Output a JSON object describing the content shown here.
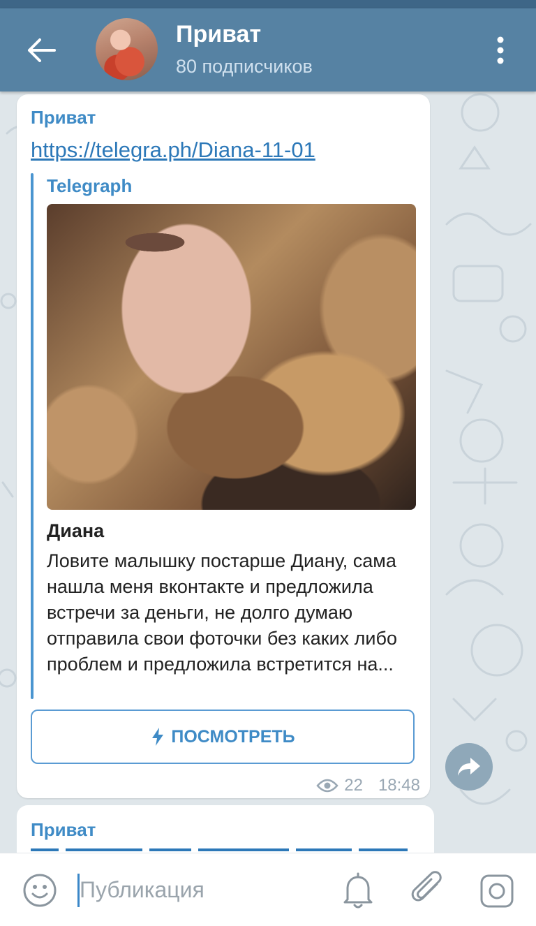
{
  "header": {
    "title": "Приват",
    "subtitle": "80 подписчиков",
    "back_icon": "arrow-left-icon",
    "menu_icon": "more-vertical-icon"
  },
  "messages": [
    {
      "sender": "Приват",
      "link": "https://telegra.ph/Diana-11-01",
      "preview": {
        "site": "Telegraph",
        "title": "Диана",
        "description": "Ловите малышку постарше Диану, сама нашла меня вконтакте и предложила встречи за деньги, не долго думаю отправила свои фоточки без каких либо проблем и предложила встретится на..."
      },
      "button_label": "ПОСМОТРЕТЬ",
      "views": "22",
      "time": "18:48"
    },
    {
      "sender": "Приват"
    }
  ],
  "composer": {
    "placeholder": "Публикация"
  },
  "colors": {
    "header": "#5682a3",
    "accent": "#3f8bc6",
    "background": "#dfe6ea"
  }
}
